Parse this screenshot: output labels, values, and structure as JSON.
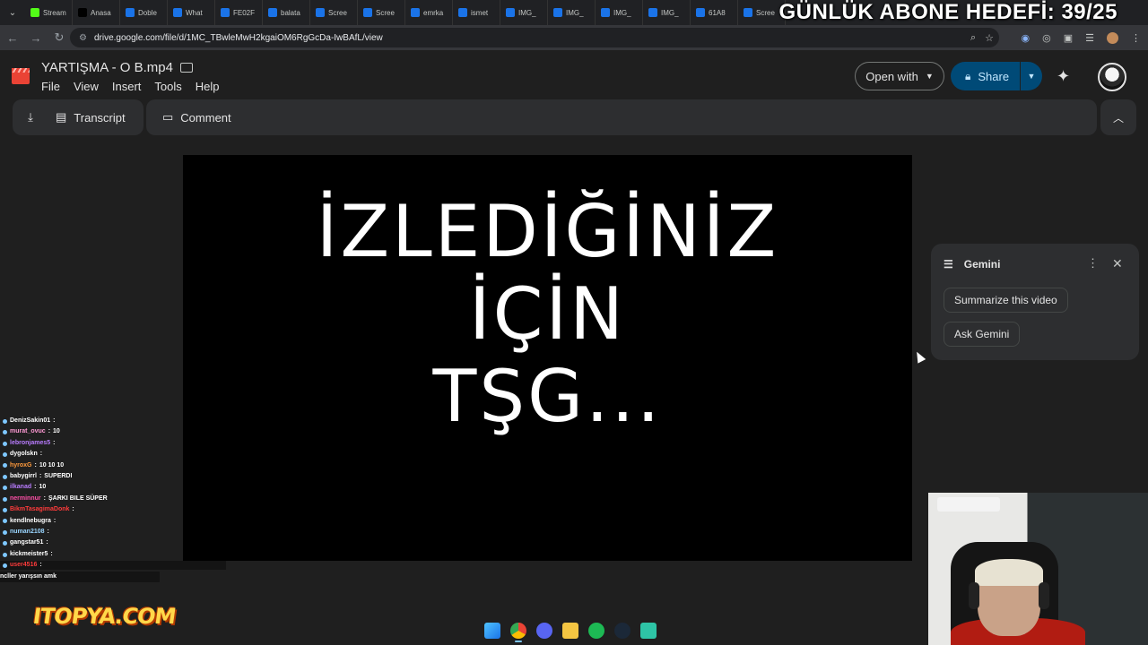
{
  "browser": {
    "tabs": [
      {
        "label": "Stream",
        "color": "#53fc18"
      },
      {
        "label": "Anasa",
        "color": "#000000"
      },
      {
        "label": "Doble",
        "color": "#1a73e8"
      },
      {
        "label": "What",
        "color": "#1a73e8"
      },
      {
        "label": "FE02F",
        "color": "#1a73e8"
      },
      {
        "label": "balata",
        "color": "#1a73e8"
      },
      {
        "label": "Scree",
        "color": "#1a73e8"
      },
      {
        "label": "Scree",
        "color": "#1a73e8"
      },
      {
        "label": "emrka",
        "color": "#1a73e8"
      },
      {
        "label": "ismet",
        "color": "#1a73e8"
      },
      {
        "label": "IMG_",
        "color": "#1a73e8"
      },
      {
        "label": "IMG_",
        "color": "#1a73e8"
      },
      {
        "label": "IMG_",
        "color": "#1a73e8"
      },
      {
        "label": "IMG_",
        "color": "#1a73e8"
      },
      {
        "label": "61A8",
        "color": "#1a73e8"
      },
      {
        "label": "Scree",
        "color": "#1a73e8"
      }
    ],
    "url": "drive.google.com/file/d/1MC_TBwleMwH2kgaiOM6RgGcDa-IwBAfL/view"
  },
  "overlay": {
    "goal_text": "GÜNLÜK ABONE HEDEFİ: 39/25",
    "logo_text": "ITOPYA.COM"
  },
  "drive": {
    "file_title": "YARTIŞMA - O B.mp4",
    "menu": [
      "File",
      "View",
      "Insert",
      "Tools",
      "Help"
    ],
    "open_with": "Open with",
    "share": "Share",
    "transcript": "Transcript",
    "comment": "Comment"
  },
  "video": {
    "lines": [
      "İZLEDİĞİNİZ",
      "İÇİN",
      "TŞG..."
    ]
  },
  "gemini": {
    "title": "Gemini",
    "chip_summarize": "Summarize this video",
    "chip_ask": "Ask Gemini"
  },
  "chat": [
    {
      "user": "DenizSakin01",
      "msg": "",
      "color": "#ffffff"
    },
    {
      "user": "murat_ovuc",
      "msg": "10",
      "color": "#ff9ad5"
    },
    {
      "user": "lebronjames5",
      "msg": "",
      "color": "#b97cff"
    },
    {
      "user": "dygolskn",
      "msg": "",
      "color": "#ffffff"
    },
    {
      "user": "hyroxG",
      "msg": "10 10 10",
      "color": "#ff9a3c"
    },
    {
      "user": "babygirrl",
      "msg": "SUPERDI",
      "color": "#ffffff"
    },
    {
      "user": "ilkanad",
      "msg": "10",
      "color": "#b97cff"
    },
    {
      "user": "nerminnur",
      "msg": "ŞARKI BILE SÜPER",
      "color": "#ff4fa8"
    },
    {
      "user": "BikmTasagimaDonk",
      "msg": "",
      "color": "#ff3b3b"
    },
    {
      "user": "kendlnebugra",
      "msg": "",
      "color": "#ffffff"
    },
    {
      "user": "numan2108",
      "msg": "",
      "color": "#9ad6ff"
    },
    {
      "user": "gangstar51",
      "msg": "",
      "color": "#ffffff"
    },
    {
      "user": "kickmeister5",
      "msg": "",
      "color": "#ffffff"
    },
    {
      "user": "user4516",
      "msg": "",
      "color": "#ff3b3b"
    }
  ],
  "chat_last": "ncller yarışsın amk"
}
